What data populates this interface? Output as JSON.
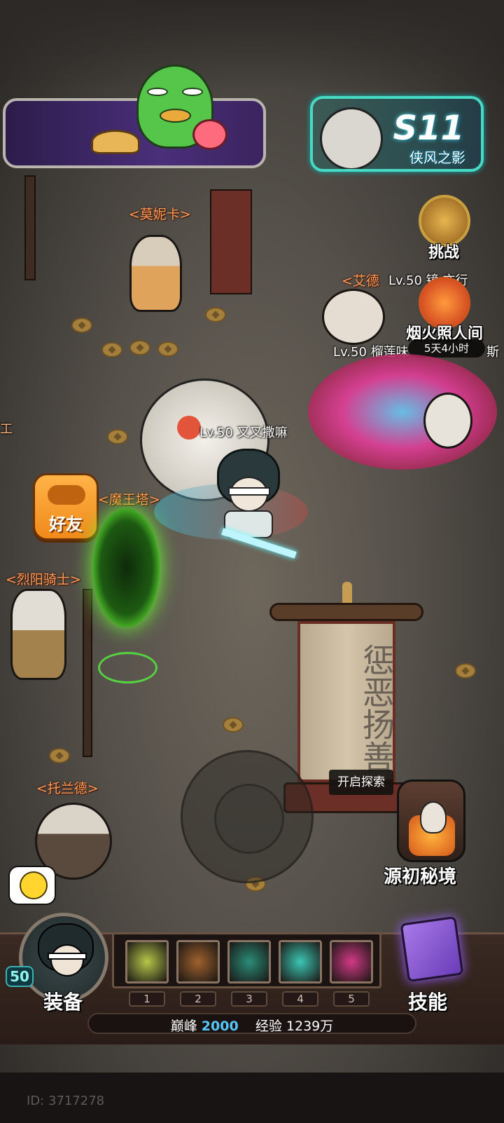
{
  "season": {
    "code": "S11",
    "subtitle": "侠风之影"
  },
  "npc_labels": {
    "monika": "<莫妮卡>",
    "devil_tower": "<魔王塔>",
    "sun_knight": "<烈阳骑士>",
    "toland": "<托兰德>",
    "aide": "<艾德",
    "left_edge": "工"
  },
  "players": [
    {
      "text": "Lv.50 叉叉撒嘛"
    },
    {
      "text": "Lv.50 榴莲味"
    },
    {
      "text": "Lv.50 镜 亦行"
    }
  ],
  "events": {
    "challenge_label": "挑战",
    "fireworks_label": "烟火照人间",
    "fireworks_timer": "5天4小时",
    "fireworks_suffix": "斯"
  },
  "buttons": {
    "friends": "好友",
    "explore": "开启探索",
    "origin_realm": "源初秘境",
    "equip": "装备",
    "skills": "技能"
  },
  "banner_text": "惩恶扬善",
  "player": {
    "level": "50"
  },
  "skill_slots": [
    {
      "num": "1",
      "icon": "golden-crescent-icon",
      "color": "#b6c74a"
    },
    {
      "num": "2",
      "icon": "straw-hat-warrior-icon",
      "color": "#a0622e"
    },
    {
      "num": "3",
      "icon": "teal-wind-icon",
      "color": "#2a8d78"
    },
    {
      "num": "4",
      "icon": "vortex-icon",
      "color": "#3cc6b4"
    },
    {
      "num": "5",
      "icon": "pink-blade-icon",
      "color": "#d23a86"
    }
  ],
  "stats": {
    "peak_label": "巅峰",
    "peak_value": "2000",
    "exp_label": "经验",
    "exp_value": "1239万"
  },
  "footer": {
    "id_text": "ID: 3717278"
  },
  "colors": {
    "accent_orange": "#ff9d5c",
    "season_border": "#46d9c4",
    "portal_green": "#5cdc2f"
  }
}
